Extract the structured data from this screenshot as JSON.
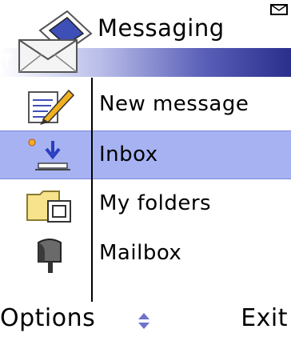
{
  "header": {
    "title": "Messaging",
    "icon": "envelope-icon",
    "signal_icon": "signal-antenna-icon",
    "message_indicator_icon": "envelope-indicator-icon",
    "colors": {
      "gradient_end": "#2a2f8c",
      "gradient_mid": "#5a5fb8"
    }
  },
  "menu": {
    "items": [
      {
        "label": "New message",
        "icon": "new-message-icon",
        "selected": false
      },
      {
        "label": "Inbox",
        "icon": "inbox-icon",
        "selected": true
      },
      {
        "label": "My folders",
        "icon": "folders-icon",
        "selected": false
      },
      {
        "label": "Mailbox",
        "icon": "mailbox-icon",
        "selected": false
      }
    ],
    "selection_color": "#a6b2f2"
  },
  "softkeys": {
    "left": "Options",
    "right": "Exit",
    "nav_icon": "up-down-arrows-icon"
  }
}
